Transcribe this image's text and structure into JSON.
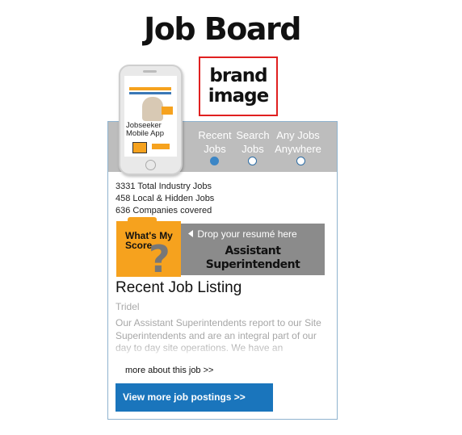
{
  "page": {
    "title": "Job Board"
  },
  "brand": {
    "line1": "brand",
    "line2": "image"
  },
  "phone": {
    "app_line1": "Jobseeker",
    "app_line2": "Mobile App"
  },
  "nav": {
    "items": [
      {
        "line1": "Recent",
        "line2": "Jobs",
        "active": true
      },
      {
        "line1": "Search",
        "line2": "Jobs",
        "active": false
      },
      {
        "line1": "Any Jobs",
        "line2": "Anywhere",
        "active": false
      }
    ]
  },
  "stats": {
    "line1": "3331 Total Industry Jobs",
    "line2": "458 Local & Hidden Jobs",
    "line3": "636 Companies covered"
  },
  "score": {
    "folder_line1": "What's My",
    "folder_line2": "Score",
    "folder_symbol": "?",
    "drop_label": "Drop your resumé here",
    "job_line1": "Assistant",
    "job_line2": "Superintendent",
    "arrow_icon": "caret-left-icon"
  },
  "listing": {
    "heading": "Recent Job Listing",
    "company": "Tridel",
    "description": "Our Assistant Superintendents report to our Site Superintendents and are an integral part of our day to day site operations. We have an outstanding record for developing industry",
    "more_link": "more about this job >>",
    "cta": "View more job postings >>"
  },
  "colors": {
    "accent_orange": "#f6a21e",
    "accent_blue": "#1a75bc",
    "header_gray": "#bdbdbd",
    "drop_gray": "#8b8b8b",
    "brand_border": "#e02020"
  }
}
